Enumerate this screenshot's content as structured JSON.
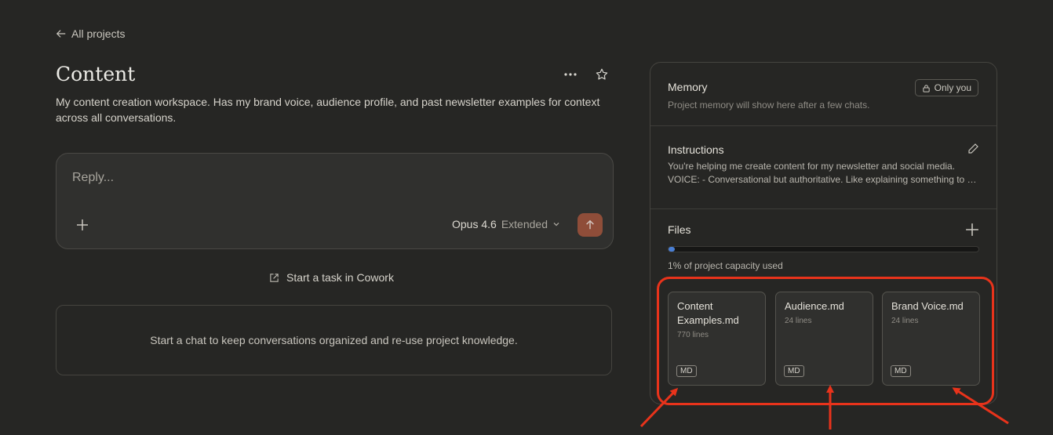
{
  "nav": {
    "back_label": "All projects",
    "back_icon": "arrow-left-icon"
  },
  "project": {
    "title": "Content",
    "description": "My content creation workspace. Has my brand voice, audience profile, and past newsletter examples for context across all conversations."
  },
  "composer": {
    "placeholder": "Reply...",
    "model_name": "Opus 4.6",
    "model_mode": "Extended"
  },
  "cowork": {
    "label": "Start a task in Cowork"
  },
  "empty_state": {
    "text": "Start a chat to keep conversations organized and re-use project knowledge."
  },
  "panel": {
    "memory": {
      "title": "Memory",
      "subtitle": "Project memory will show here after a few chats.",
      "visibility": "Only you"
    },
    "instructions": {
      "title": "Instructions",
      "line1": "You're helping me create content for my newsletter and social media.",
      "line2": "VOICE: - Conversational but authoritative. Like explaining something to a smart friend."
    },
    "files": {
      "title": "Files",
      "capacity_fraction": 0.01,
      "capacity_text": "1% of project capacity used",
      "items": [
        {
          "name": "Content Examples.md",
          "lines": "770 lines",
          "badge": "MD"
        },
        {
          "name": "Audience.md",
          "lines": "24 lines",
          "badge": "MD"
        },
        {
          "name": "Brand Voice.md",
          "lines": "24 lines",
          "badge": "MD"
        }
      ]
    }
  },
  "colors": {
    "accent_send": "#a0533b",
    "progress_fill": "#4a7fd4",
    "annotation_red": "#e8331b"
  }
}
